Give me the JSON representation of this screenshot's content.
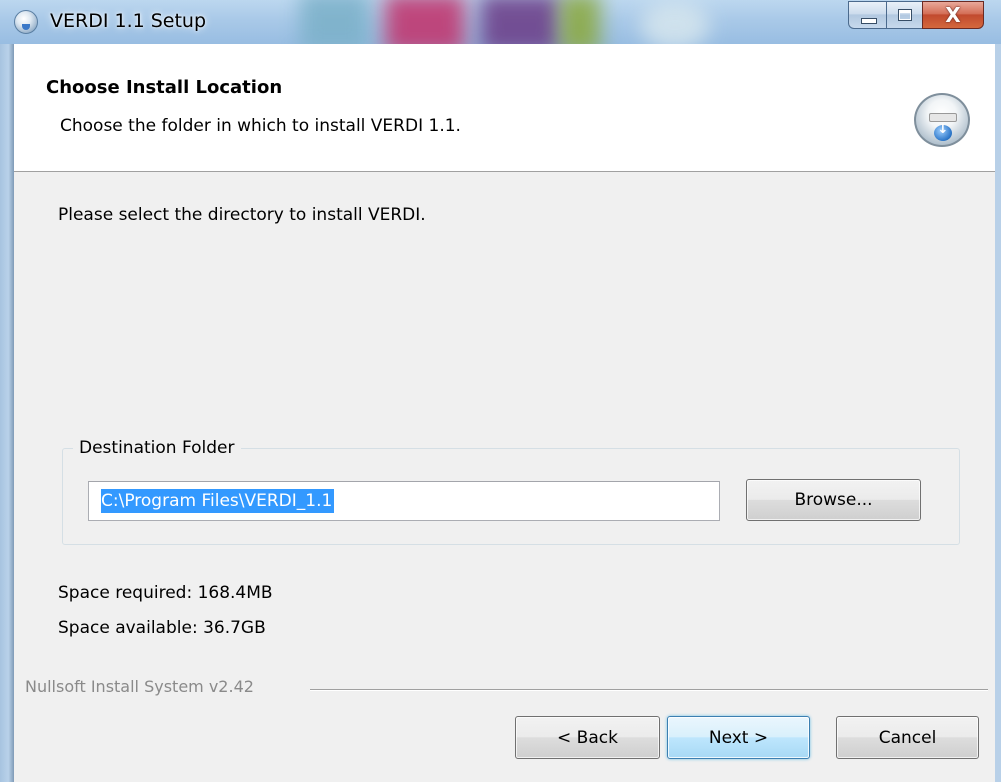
{
  "window": {
    "title": "VERDI 1.1 Setup",
    "close_glyph": "X"
  },
  "header": {
    "title": "Choose Install Location",
    "subtitle": "Choose the folder in which to install VERDI 1.1."
  },
  "body": {
    "instruction": "Please select the directory to install VERDI.",
    "destination": {
      "group_label": "Destination Folder",
      "path": "C:\\Program Files\\VERDI_1.1",
      "browse_label": "Browse..."
    },
    "space_required": "Space required: 168.4MB",
    "space_available": "Space available: 36.7GB"
  },
  "footer": {
    "branding": "Nullsoft Install System v2.42",
    "back_label": "< Back",
    "next_label": "Next >",
    "cancel_label": "Cancel"
  },
  "colors": {
    "selection": "#3399ff",
    "default_button_border": "#3c7fb1",
    "close_button": "#c14a2e"
  },
  "icons": {
    "app": "installer-disc-icon",
    "header": "install-disc-icon"
  }
}
